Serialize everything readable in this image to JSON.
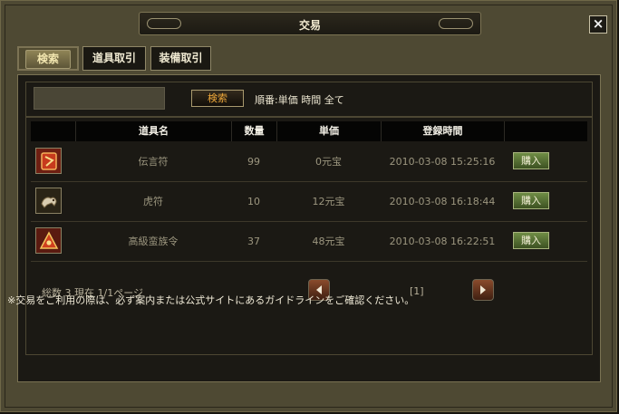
{
  "window": {
    "title": "交易",
    "close_label": "×"
  },
  "tabs": [
    {
      "label": "検索",
      "active": true
    },
    {
      "label": "道具取引",
      "active": false
    },
    {
      "label": "装備取引",
      "active": false
    }
  ],
  "search": {
    "input_value": "",
    "button_label": "検索",
    "sort_label": "順番:単価 時間 全て"
  },
  "table": {
    "headers": [
      "道具名",
      "数量",
      "単価",
      "登録時間"
    ],
    "rows": [
      {
        "icon": "red-talisman-icon",
        "name": "伝言符",
        "qty": "99",
        "price": "0元宝",
        "time": "2010-03-08 15:25:16",
        "action": "購入"
      },
      {
        "icon": "tiger-tally-icon",
        "name": "虎符",
        "qty": "10",
        "price": "12元宝",
        "time": "2010-03-08 16:18:44",
        "action": "購入"
      },
      {
        "icon": "barbarian-order-icon",
        "name": "高級蛮族令",
        "qty": "37",
        "price": "48元宝",
        "time": "2010-03-08 16:22:51",
        "action": "購入"
      }
    ]
  },
  "pagination": {
    "summary": "総数 3  現在  1/1ページ",
    "current_page": "[1]"
  },
  "footer": {
    "note": "※交易をご利用の際は、必ず案内または公式サイトにあるガイドラインをご確認ください。"
  },
  "colors": {
    "frame": "#4e4933",
    "panel": "#1b1914",
    "accent": "#f0a93a",
    "buy_button": "#5a7a33"
  }
}
